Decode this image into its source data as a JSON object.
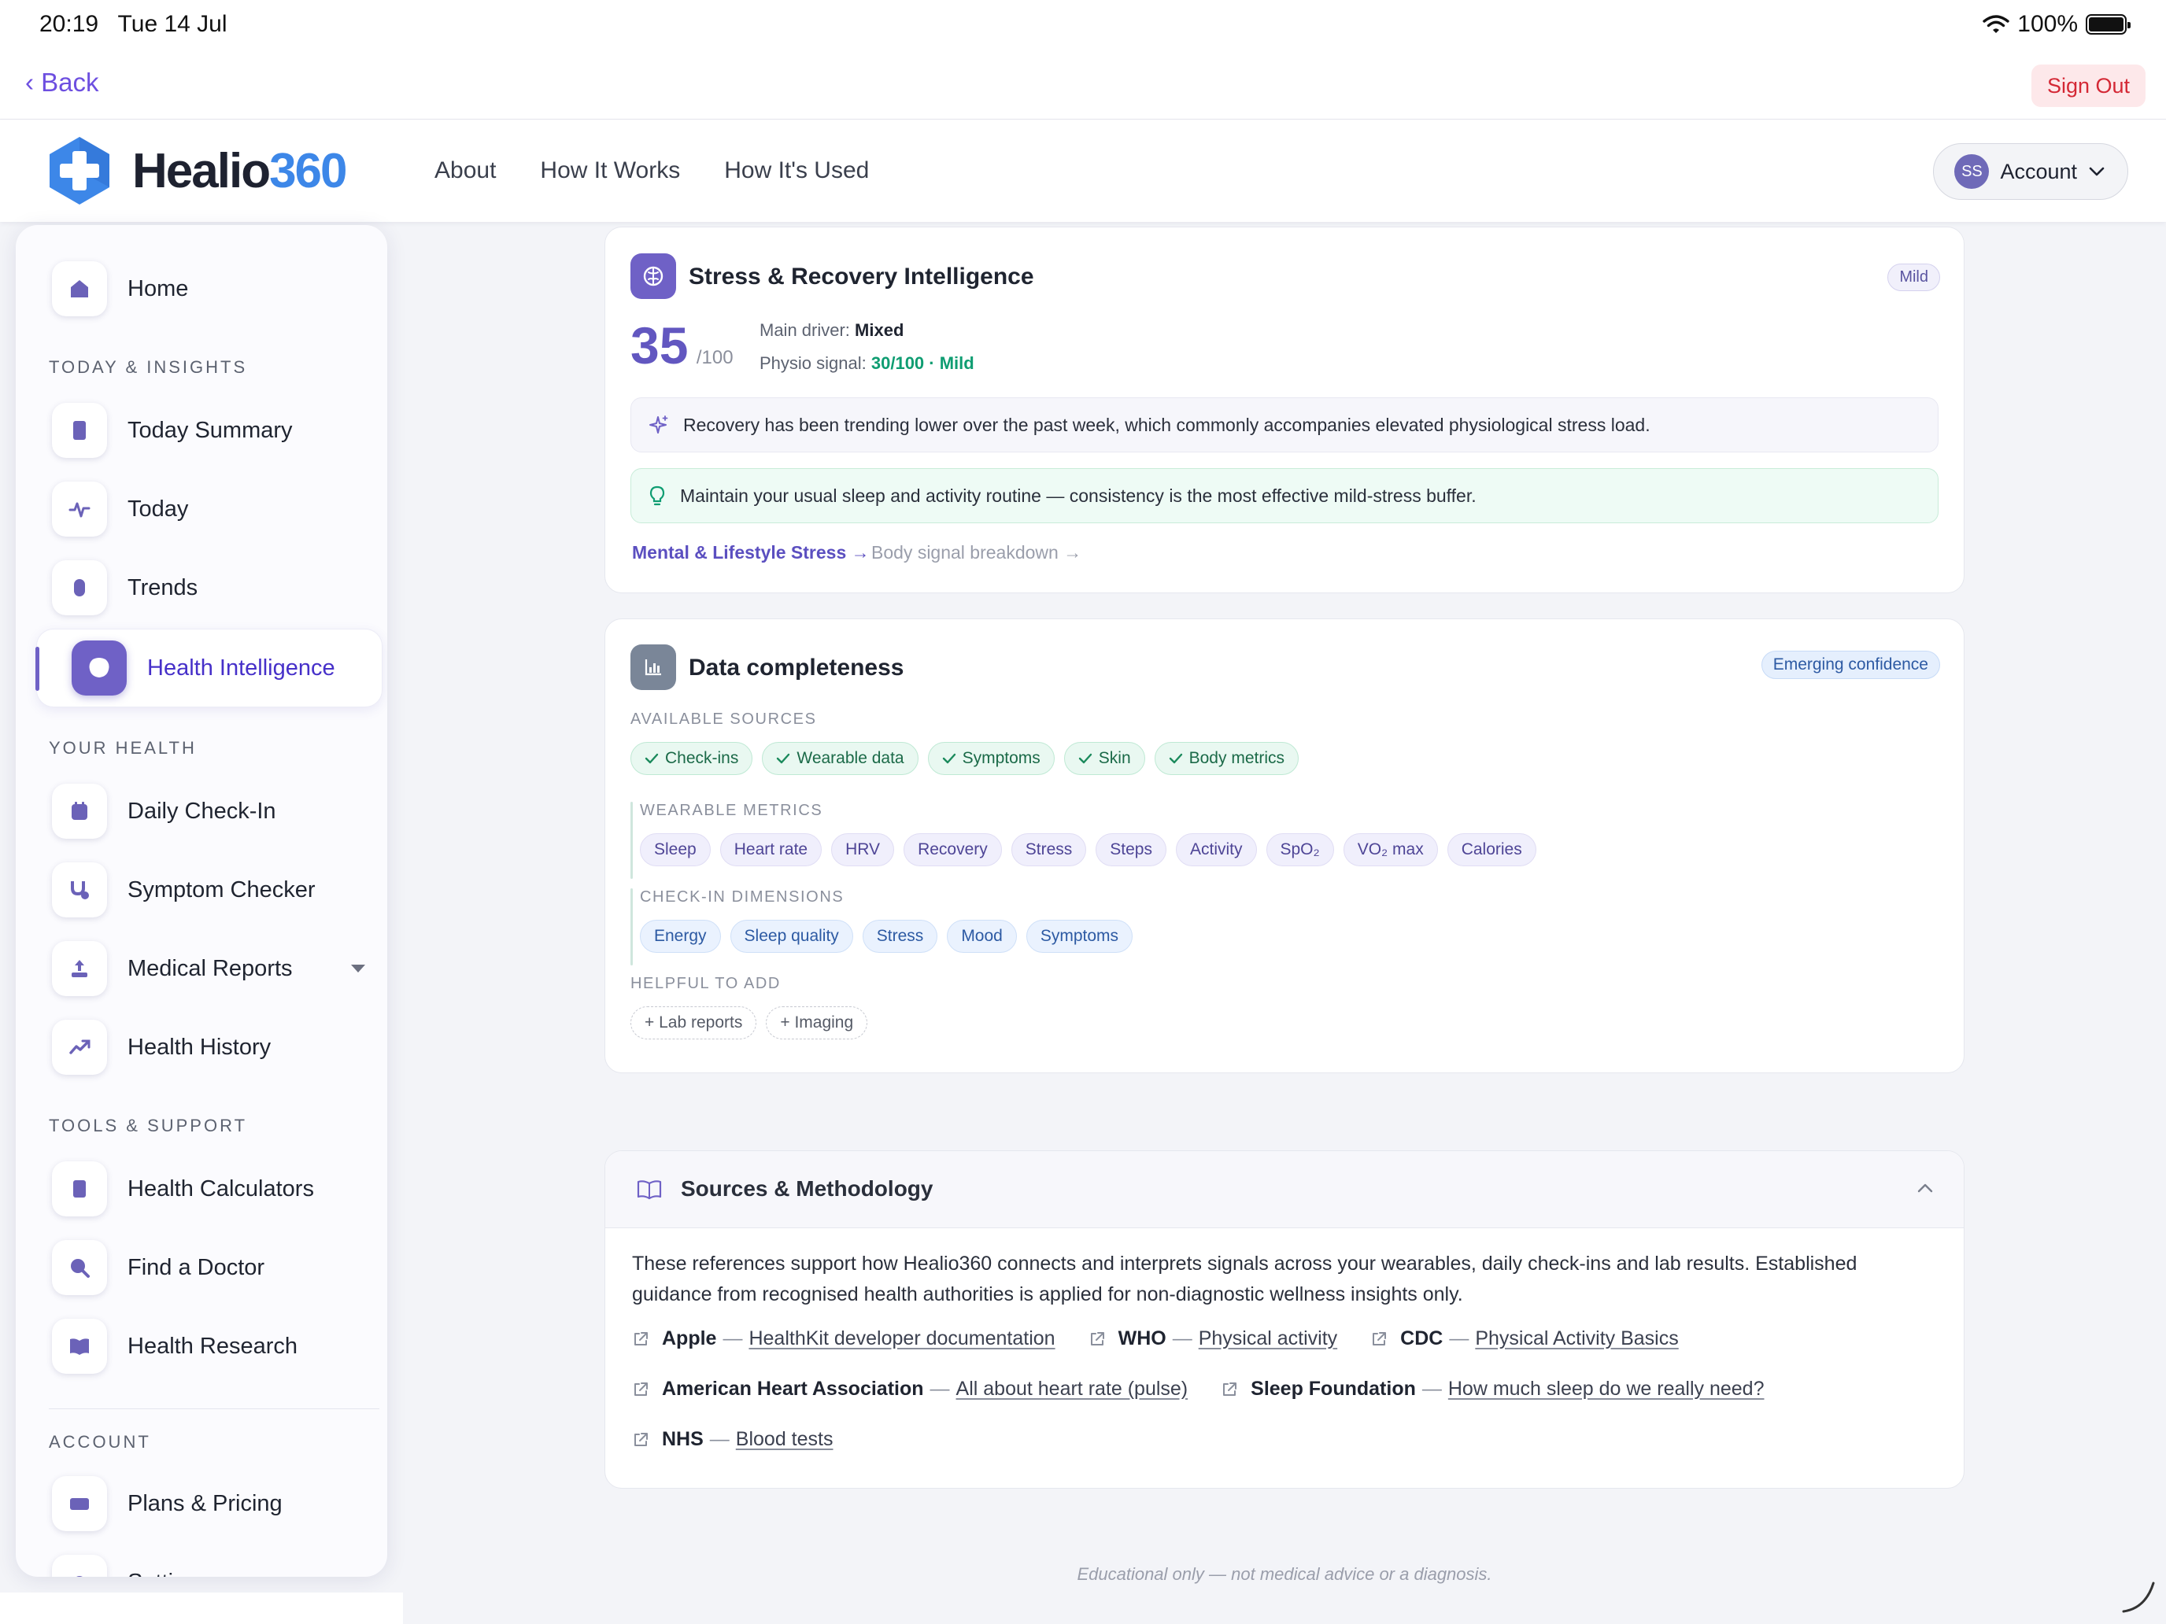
{
  "status_bar": {
    "time": "20:19",
    "date": "Tue 14 Jul",
    "battery": "100%"
  },
  "topbar": {
    "back_label": "‹ Back",
    "signout_label": "Sign Out"
  },
  "header": {
    "logo_word_1": "Healio",
    "logo_word_2": "360",
    "nav": [
      "About",
      "How It Works",
      "How It's Used"
    ],
    "account": {
      "initials": "SS",
      "label": "Account"
    }
  },
  "sidebar": {
    "home": "Home",
    "sections": {
      "today": "TODAY & INSIGHTS",
      "health": "YOUR HEALTH",
      "tools": "TOOLS & SUPPORT",
      "account": "ACCOUNT"
    },
    "items": {
      "today_summary": "Today Summary",
      "today": "Today",
      "trends": "Trends",
      "health_intelligence": "Health Intelligence",
      "daily_checkin": "Daily Check-In",
      "symptom_checker": "Symptom Checker",
      "medical_reports": "Medical Reports",
      "health_history": "Health History",
      "health_calculators": "Health Calculators",
      "find_doctor": "Find a Doctor",
      "health_research": "Health Research",
      "plans_pricing": "Plans & Pricing",
      "settings_partial": "Setti"
    }
  },
  "stress_card": {
    "title": "Stress & Recovery Intelligence",
    "badge": "Mild",
    "score": "35",
    "score_max": "/100",
    "main_driver_label": "Main driver:",
    "main_driver_value": "Mixed",
    "physio_label": "Physio signal:",
    "physio_value": "30/100 · Mild",
    "insight": "Recovery has been trending lower over the past week, which commonly accompanies elevated physiological stress load.",
    "tip": "Maintain your usual sleep and activity routine — consistency is the most effective mild-stress buffer.",
    "link_primary": "Mental & Lifestyle Stress →",
    "link_secondary": "Body signal breakdown →"
  },
  "data_card": {
    "title": "Data completeness",
    "badge": "Emerging confidence",
    "available_label": "AVAILABLE SOURCES",
    "sources": [
      "Check-ins",
      "Wearable data",
      "Symptoms",
      "Skin",
      "Body metrics"
    ],
    "wearable_label": "WEARABLE METRICS",
    "wearable_metrics": [
      "Sleep",
      "Heart rate",
      "HRV",
      "Recovery",
      "Stress",
      "Steps",
      "Activity",
      "SpO₂",
      "VO₂ max",
      "Calories"
    ],
    "checkin_label": "CHECK-IN DIMENSIONS",
    "checkin_dimensions": [
      "Energy",
      "Sleep quality",
      "Stress",
      "Mood",
      "Symptoms"
    ],
    "helpful_label": "HELPFUL TO ADD",
    "helpful": [
      "+ Lab reports",
      "+ Imaging"
    ]
  },
  "sources_card": {
    "title": "Sources & Methodology",
    "text_line1": "These references support how Healio360 connects and interprets signals across your wearables, daily check-ins and lab results. Established",
    "text_line2": "guidance from recognised health authorities is applied for non-diagnostic wellness insights only.",
    "refs": [
      {
        "org": "Apple",
        "title": "HealthKit developer documentation"
      },
      {
        "org": "WHO",
        "title": "Physical activity"
      },
      {
        "org": "CDC",
        "title": "Physical Activity Basics"
      },
      {
        "org": "American Heart Association",
        "title": "All about heart rate (pulse)"
      },
      {
        "org": "Sleep Foundation",
        "title": "How much sleep do we really need?"
      },
      {
        "org": "NHS",
        "title": "Blood tests"
      }
    ]
  },
  "footer": {
    "disclaimer": "Educational only — not medical advice or a diagnosis."
  },
  "colors": {
    "accent": "#6f61c6",
    "brand_blue": "#3d87e8",
    "danger": "#d42835",
    "success": "#0f9d72"
  }
}
